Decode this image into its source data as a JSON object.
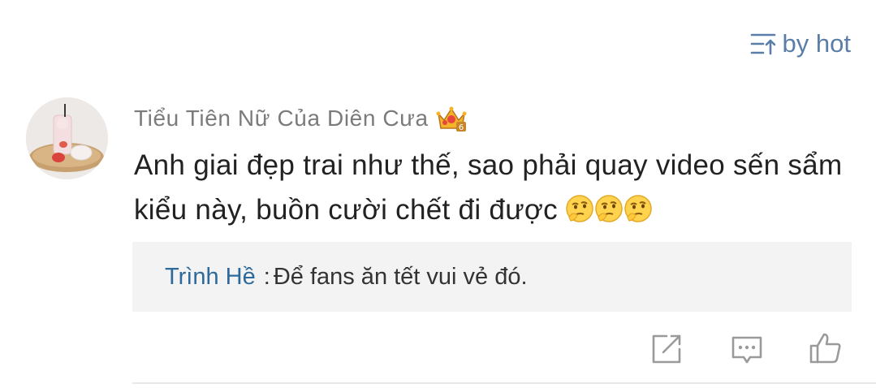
{
  "sort": {
    "label": "by hot",
    "icon": "sort-ascending-icon"
  },
  "comment": {
    "author": "Tiểu Tiên Nữ Của Diên Cưa",
    "badge_icon": "crown-level-6-icon",
    "text": "Anh giai đẹp trai như thế, sao phải quay video sến sẩm kiểu này, buồn cười chết đi được",
    "emoji_icons": [
      "thinking-face-icon",
      "thinking-face-icon",
      "thinking-face-icon"
    ]
  },
  "reply": {
    "author": "Trình Hề",
    "separator": ":",
    "text": "Để fans ăn tết vui vẻ đó."
  },
  "actions": [
    "share-icon",
    "comment-icon",
    "like-icon"
  ],
  "colors": {
    "link_blue": "#5a7ea8",
    "reply_author": "#2d6a9b",
    "reply_bg": "#f3f3f3",
    "icon_gray": "#9a9a9a"
  }
}
